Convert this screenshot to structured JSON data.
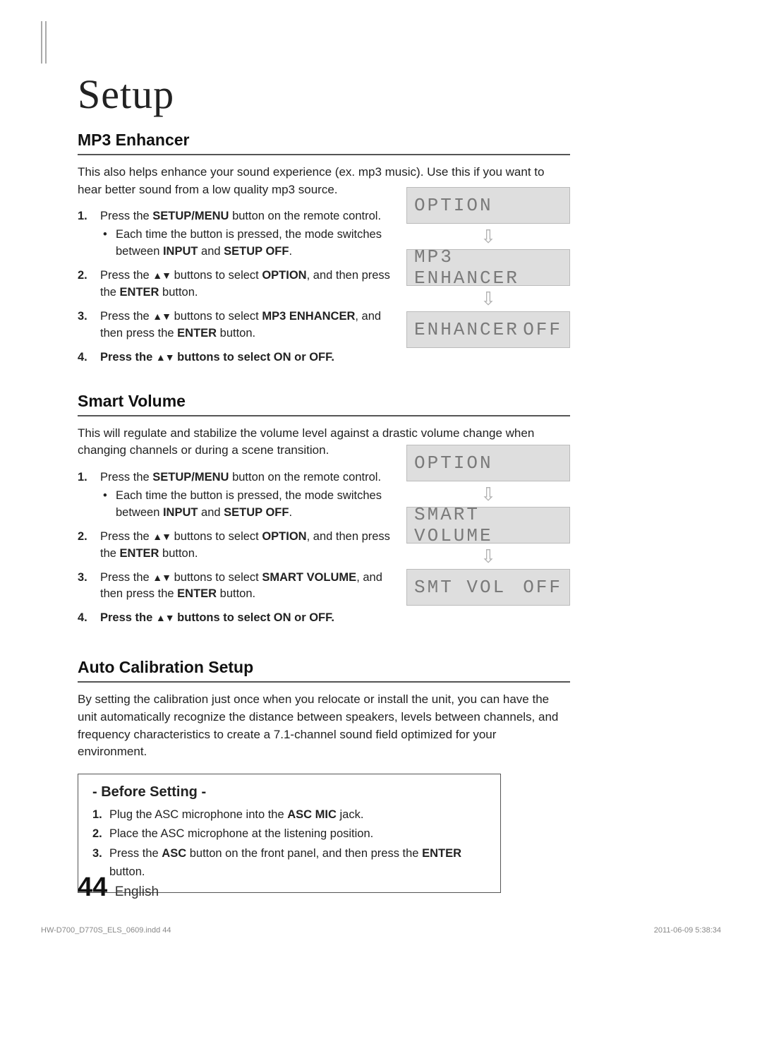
{
  "chapter": "Setup",
  "mp3": {
    "title": "MP3 Enhancer",
    "desc": "This also helps enhance your sound experience (ex. mp3 music). Use this if you want to hear better sound from a low quality mp3 source.",
    "step1_a": "Press the ",
    "step1_b": "SETUP/MENU",
    "step1_c": " button on the remote control.",
    "step1_sub_a": "Each time the button is pressed, the mode switches between ",
    "step1_sub_b": "INPUT",
    "step1_sub_c": " and ",
    "step1_sub_d": "SETUP OFF",
    "step1_sub_e": ".",
    "step2_a": "Press the ",
    "step2_b": " buttons to select ",
    "step2_c": "OPTION",
    "step2_d": ", and then press the ",
    "step2_e": "ENTER",
    "step2_f": " button.",
    "step3_a": "Press the ",
    "step3_b": " buttons to select ",
    "step3_c": "MP3 ENHANCER",
    "step3_d": ", and then press the ",
    "step3_e": "ENTER",
    "step3_f": " button.",
    "step4_a": "Press the ",
    "step4_b": " buttons to select ",
    "step4_c": "ON",
    "step4_d": " or ",
    "step4_e": "OFF.",
    "lcd1": "OPTION",
    "lcd2": "MP3 ENHANCER",
    "lcd3_a": "ENHANCER",
    "lcd3_b": "OFF"
  },
  "sv": {
    "title": "Smart Volume",
    "desc": "This will regulate and stabilize the volume level against a drastic volume change when changing channels or during a scene transition.",
    "step1_a": "Press the ",
    "step1_b": "SETUP/MENU",
    "step1_c": " button on the remote control.",
    "step1_sub_a": "Each time the button is pressed, the mode switches between ",
    "step1_sub_b": "INPUT",
    "step1_sub_c": " and ",
    "step1_sub_d": "SETUP OFF",
    "step1_sub_e": ".",
    "step2_a": "Press the ",
    "step2_b": " buttons to select ",
    "step2_c": "OPTION",
    "step2_d": ", and then press the ",
    "step2_e": "ENTER",
    "step2_f": " button.",
    "step3_a": "Press the ",
    "step3_b": " buttons to select ",
    "step3_c": "SMART VOLUME",
    "step3_d": ", and then press the ",
    "step3_e": "ENTER",
    "step3_f": " button.",
    "step4_a": "Press the ",
    "step4_b": " buttons to select ",
    "step4_c": "ON",
    "step4_d": " or ",
    "step4_e": "OFF.",
    "lcd1": "OPTION",
    "lcd2": "SMART VOLUME",
    "lcd3_a": "SMT VOL",
    "lcd3_b": "OFF"
  },
  "ac": {
    "title": "Auto Calibration Setup",
    "desc": "By setting the calibration just once when you relocate or install the unit, you can have the unit automatically recognize the distance between speakers, levels between channels, and frequency characteristics to create a 7.1-channel sound field optimized for your environment.",
    "before_title": "- Before Setting -",
    "b1_a": "Plug the ASC microphone into the ",
    "b1_b": "ASC MIC",
    "b1_c": " jack.",
    "b2": "Place the ASC microphone at the listening position.",
    "b3_a": "Press the ",
    "b3_b": "ASC",
    "b3_c": " button on the front panel, and then press the ",
    "b3_d": "ENTER",
    "b3_e": " button."
  },
  "footer": {
    "num": "44",
    "lang": "English",
    "file": "HW-D700_D770S_ELS_0609.indd   44",
    "ts": "2011-06-09   5:38:34"
  },
  "glyph": {
    "updown": "▲▼",
    "down": "⇩"
  }
}
